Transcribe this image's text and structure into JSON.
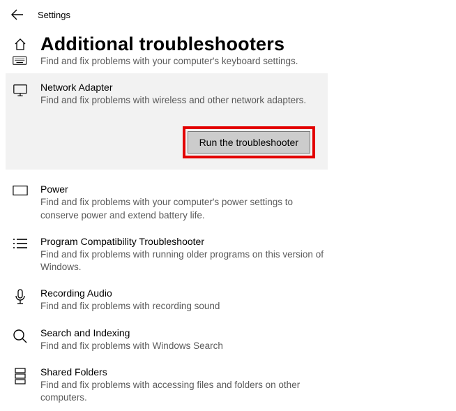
{
  "header": {
    "back_label": "Back",
    "title": "Settings"
  },
  "page": {
    "title": "Additional troubleshooters"
  },
  "truncated": {
    "desc": "Find and fix problems with your computer's keyboard settings."
  },
  "selected": {
    "title": "Network Adapter",
    "desc": "Find and fix problems with wireless and other network adapters.",
    "button": "Run the troubleshooter"
  },
  "items": [
    {
      "title": "Power",
      "desc": "Find and fix problems with your computer's power settings to conserve power and extend battery life."
    },
    {
      "title": "Program Compatibility Troubleshooter",
      "desc": "Find and fix problems with running older programs on this version of Windows."
    },
    {
      "title": "Recording Audio",
      "desc": "Find and fix problems with recording sound"
    },
    {
      "title": "Search and Indexing",
      "desc": "Find and fix problems with Windows Search"
    },
    {
      "title": "Shared Folders",
      "desc": "Find and fix problems with accessing files and folders on other computers."
    }
  ]
}
